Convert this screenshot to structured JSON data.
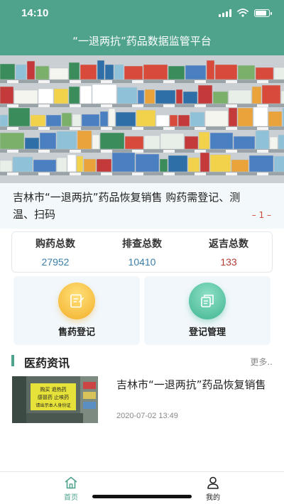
{
  "status_bar": {
    "time": "14:10"
  },
  "header": {
    "title": "“一退两抗”药品数据监管平台"
  },
  "news_strip": {
    "text": "吉林市“一退两抗”药品恢复销售 购药需登记、测温、扫码",
    "page": "– 1 –"
  },
  "stats": [
    {
      "label": "购药总数",
      "value": "27952",
      "color": "#3a7fa8"
    },
    {
      "label": "排查总数",
      "value": "10410",
      "color": "#3a7fa8"
    },
    {
      "label": "返吉总数",
      "value": "133",
      "color": "#b33a33"
    }
  ],
  "tiles": [
    {
      "label": "售药登记",
      "icon": "edit-document-icon",
      "color": "#f3b02a"
    },
    {
      "label": "登记管理",
      "icon": "copy-document-icon",
      "color": "#3fb591"
    }
  ],
  "section": {
    "title": "医药资讯",
    "more": "更多.."
  },
  "article": {
    "title": "吉林市“一退两抗”药品恢复销售",
    "date": "2020-07-02 13:49",
    "thumb_sign": [
      "购买 退热药",
      "感冒药 止咳药",
      "请出示本人身份证"
    ]
  },
  "tabbar": {
    "home": {
      "label": "首页",
      "icon": "home-icon",
      "active_color": "#4fa38d"
    },
    "me": {
      "label": "我的",
      "icon": "user-icon"
    }
  },
  "colors": {
    "brand": "#4fa38d",
    "card_bg": "#f1f7fb"
  }
}
